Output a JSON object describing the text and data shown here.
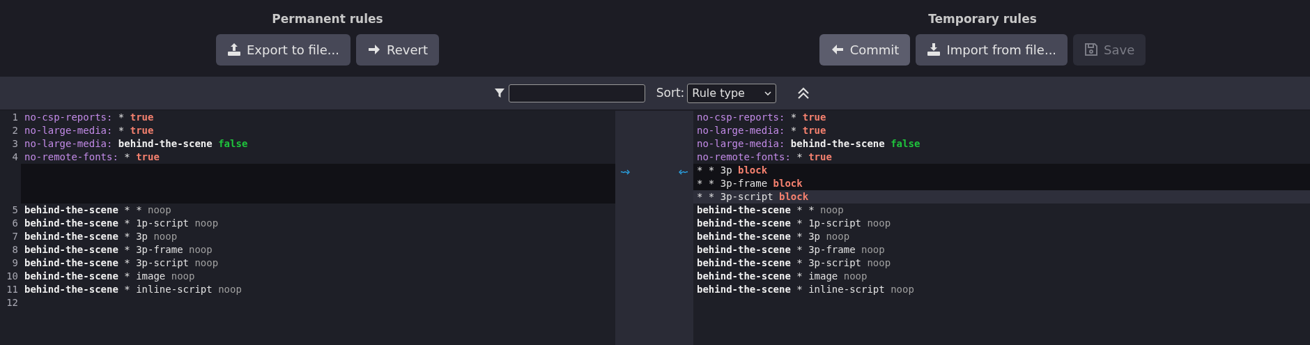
{
  "permanent": {
    "title": "Permanent rules",
    "buttons": [
      {
        "label": "Export to file...",
        "kind": "upload",
        "disabled": false,
        "hovered": false
      },
      {
        "label": "Revert",
        "kind": "arrow-right",
        "disabled": false,
        "hovered": false
      }
    ]
  },
  "temporary": {
    "title": "Temporary rules",
    "buttons": [
      {
        "label": "Commit",
        "kind": "arrow-left",
        "disabled": false,
        "hovered": true
      },
      {
        "label": "Import from file...",
        "kind": "download",
        "disabled": false,
        "hovered": false
      },
      {
        "label": "Save",
        "kind": "floppy",
        "disabled": true,
        "hovered": false
      }
    ]
  },
  "toolbar": {
    "sort_label": "Sort:",
    "sort_value": "Rule type"
  },
  "left_pane": {
    "lines": [
      {
        "kind": "line",
        "number": "1",
        "tokens": [
          {
            "kind": "key",
            "text": "no-csp-reports:"
          },
          {
            "kind": "plain",
            "text": " * "
          },
          {
            "kind": "true",
            "text": "true"
          }
        ]
      },
      {
        "kind": "line",
        "number": "2",
        "tokens": [
          {
            "kind": "key",
            "text": "no-large-media:"
          },
          {
            "kind": "plain",
            "text": " * "
          },
          {
            "kind": "true",
            "text": "true"
          }
        ]
      },
      {
        "kind": "line",
        "number": "3",
        "tokens": [
          {
            "kind": "key",
            "text": "no-large-media:"
          },
          {
            "kind": "bold",
            "text": " behind-the-scene"
          },
          {
            "kind": "false",
            "text": " false"
          }
        ]
      },
      {
        "kind": "line",
        "number": "4",
        "tokens": [
          {
            "kind": "key",
            "text": "no-remote-fonts:"
          },
          {
            "kind": "plain",
            "text": " * "
          },
          {
            "kind": "true",
            "text": "true"
          }
        ]
      },
      {
        "kind": "gap"
      },
      {
        "kind": "line",
        "number": "5",
        "tokens": [
          {
            "kind": "bold",
            "text": "behind-the-scene"
          },
          {
            "kind": "plain",
            "text": " * * "
          },
          {
            "kind": "noop",
            "text": "noop"
          }
        ]
      },
      {
        "kind": "line",
        "number": "6",
        "tokens": [
          {
            "kind": "bold",
            "text": "behind-the-scene"
          },
          {
            "kind": "plain",
            "text": " * 1p-script "
          },
          {
            "kind": "noop",
            "text": "noop"
          }
        ]
      },
      {
        "kind": "line",
        "number": "7",
        "tokens": [
          {
            "kind": "bold",
            "text": "behind-the-scene"
          },
          {
            "kind": "plain",
            "text": " * 3p "
          },
          {
            "kind": "noop",
            "text": "noop"
          }
        ]
      },
      {
        "kind": "line",
        "number": "8",
        "tokens": [
          {
            "kind": "bold",
            "text": "behind-the-scene"
          },
          {
            "kind": "plain",
            "text": " * 3p-frame "
          },
          {
            "kind": "noop",
            "text": "noop"
          }
        ]
      },
      {
        "kind": "line",
        "number": "9",
        "tokens": [
          {
            "kind": "bold",
            "text": "behind-the-scene"
          },
          {
            "kind": "plain",
            "text": " * 3p-script "
          },
          {
            "kind": "noop",
            "text": "noop"
          }
        ]
      },
      {
        "kind": "line",
        "number": "10",
        "tokens": [
          {
            "kind": "bold",
            "text": "behind-the-scene"
          },
          {
            "kind": "plain",
            "text": " * image "
          },
          {
            "kind": "noop",
            "text": "noop"
          }
        ]
      },
      {
        "kind": "line",
        "number": "11",
        "tokens": [
          {
            "kind": "bold",
            "text": "behind-the-scene"
          },
          {
            "kind": "plain",
            "text": " * inline-script "
          },
          {
            "kind": "noop",
            "text": "noop"
          }
        ]
      },
      {
        "kind": "line",
        "number": "12"
      }
    ]
  },
  "right_pane": {
    "lines": [
      {
        "kind": "line",
        "current": false,
        "tokens": [
          {
            "kind": "key",
            "text": "no-csp-reports:"
          },
          {
            "kind": "plain",
            "text": " * "
          },
          {
            "kind": "true",
            "text": "true"
          }
        ]
      },
      {
        "kind": "line",
        "current": false,
        "tokens": [
          {
            "kind": "key",
            "text": "no-large-media:"
          },
          {
            "kind": "plain",
            "text": " * "
          },
          {
            "kind": "true",
            "text": "true"
          }
        ]
      },
      {
        "kind": "line",
        "current": false,
        "tokens": [
          {
            "kind": "key",
            "text": "no-large-media:"
          },
          {
            "kind": "bold",
            "text": " behind-the-scene"
          },
          {
            "kind": "false",
            "text": " false"
          }
        ]
      },
      {
        "kind": "line",
        "current": false,
        "tokens": [
          {
            "kind": "key",
            "text": "no-remote-fonts:"
          },
          {
            "kind": "plain",
            "text": " * "
          },
          {
            "kind": "true",
            "text": "true"
          }
        ]
      },
      {
        "kind": "added",
        "current": false,
        "tokens": [
          {
            "kind": "plain",
            "text": "* * 3p "
          },
          {
            "kind": "true",
            "text": "block"
          }
        ]
      },
      {
        "kind": "added",
        "current": false,
        "tokens": [
          {
            "kind": "plain",
            "text": "* * 3p-frame "
          },
          {
            "kind": "true",
            "text": "block"
          }
        ]
      },
      {
        "kind": "added",
        "current": true,
        "tokens": [
          {
            "kind": "plain",
            "text": "* * 3p-script "
          },
          {
            "kind": "true",
            "text": "block"
          }
        ]
      },
      {
        "kind": "line",
        "current": false,
        "tokens": [
          {
            "kind": "bold",
            "text": "behind-the-scene"
          },
          {
            "kind": "plain",
            "text": " * * "
          },
          {
            "kind": "noop",
            "text": "noop"
          }
        ]
      },
      {
        "kind": "line",
        "current": false,
        "tokens": [
          {
            "kind": "bold",
            "text": "behind-the-scene"
          },
          {
            "kind": "plain",
            "text": " * 1p-script "
          },
          {
            "kind": "noop",
            "text": "noop"
          }
        ]
      },
      {
        "kind": "line",
        "current": false,
        "tokens": [
          {
            "kind": "bold",
            "text": "behind-the-scene"
          },
          {
            "kind": "plain",
            "text": " * 3p "
          },
          {
            "kind": "noop",
            "text": "noop"
          }
        ]
      },
      {
        "kind": "line",
        "current": false,
        "tokens": [
          {
            "kind": "bold",
            "text": "behind-the-scene"
          },
          {
            "kind": "plain",
            "text": " * 3p-frame "
          },
          {
            "kind": "noop",
            "text": "noop"
          }
        ]
      },
      {
        "kind": "line",
        "current": false,
        "tokens": [
          {
            "kind": "bold",
            "text": "behind-the-scene"
          },
          {
            "kind": "plain",
            "text": " * 3p-script "
          },
          {
            "kind": "noop",
            "text": "noop"
          }
        ]
      },
      {
        "kind": "line",
        "current": false,
        "tokens": [
          {
            "kind": "bold",
            "text": "behind-the-scene"
          },
          {
            "kind": "plain",
            "text": " * image "
          },
          {
            "kind": "noop",
            "text": "noop"
          }
        ]
      },
      {
        "kind": "line",
        "current": false,
        "tokens": [
          {
            "kind": "bold",
            "text": "behind-the-scene"
          },
          {
            "kind": "plain",
            "text": " * inline-script "
          },
          {
            "kind": "noop",
            "text": "noop"
          }
        ]
      }
    ]
  }
}
